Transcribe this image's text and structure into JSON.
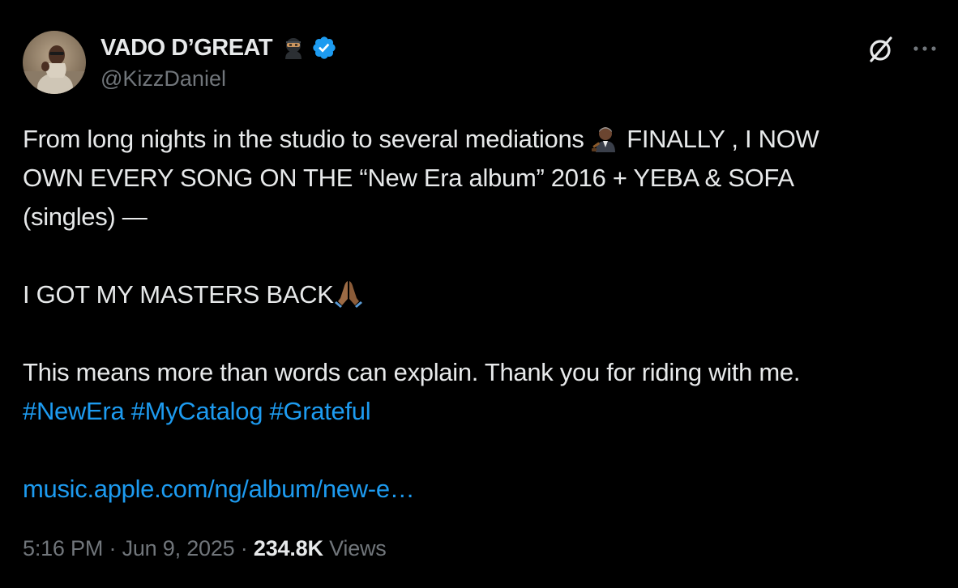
{
  "author": {
    "display_name": "VADO D’GREAT",
    "name_emoji": "ninja-emoji",
    "verified_icon": "verified-badge-icon",
    "handle": "@KizzDaniel",
    "avatar": "profile-avatar"
  },
  "header_actions": {
    "grok_icon": "grok-icon",
    "more_icon": "more-options-icon"
  },
  "tweet": {
    "line1_text": "From long nights in the studio to several mediations ",
    "line1_emoji": "man-judge-emoji",
    "line1_after": " FINALLY , I NOW",
    "line2": "OWN EVERY SONG ON THE “New Era album” 2016 + YEBA & SOFA",
    "line3": "(singles) —",
    "line4_text": "I GOT MY MASTERS BACK",
    "line4_emoji": "folded-hands-emoji",
    "line5": "This means more than words can explain. Thank you for riding with me.",
    "hashtags": [
      "#NewEra",
      "#MyCatalog",
      "#Grateful"
    ],
    "link": "music.apple.com/ng/album/new-e…"
  },
  "meta": {
    "time": "5:16 PM",
    "separator": " · ",
    "date": "Jun 9, 2025",
    "views_count": "234.8K",
    "views_label": "Views"
  },
  "colors": {
    "background": "#000000",
    "text": "#e7e9ea",
    "secondary": "#71767b",
    "link": "#1d9bf0",
    "verified": "#1d9bf0"
  }
}
